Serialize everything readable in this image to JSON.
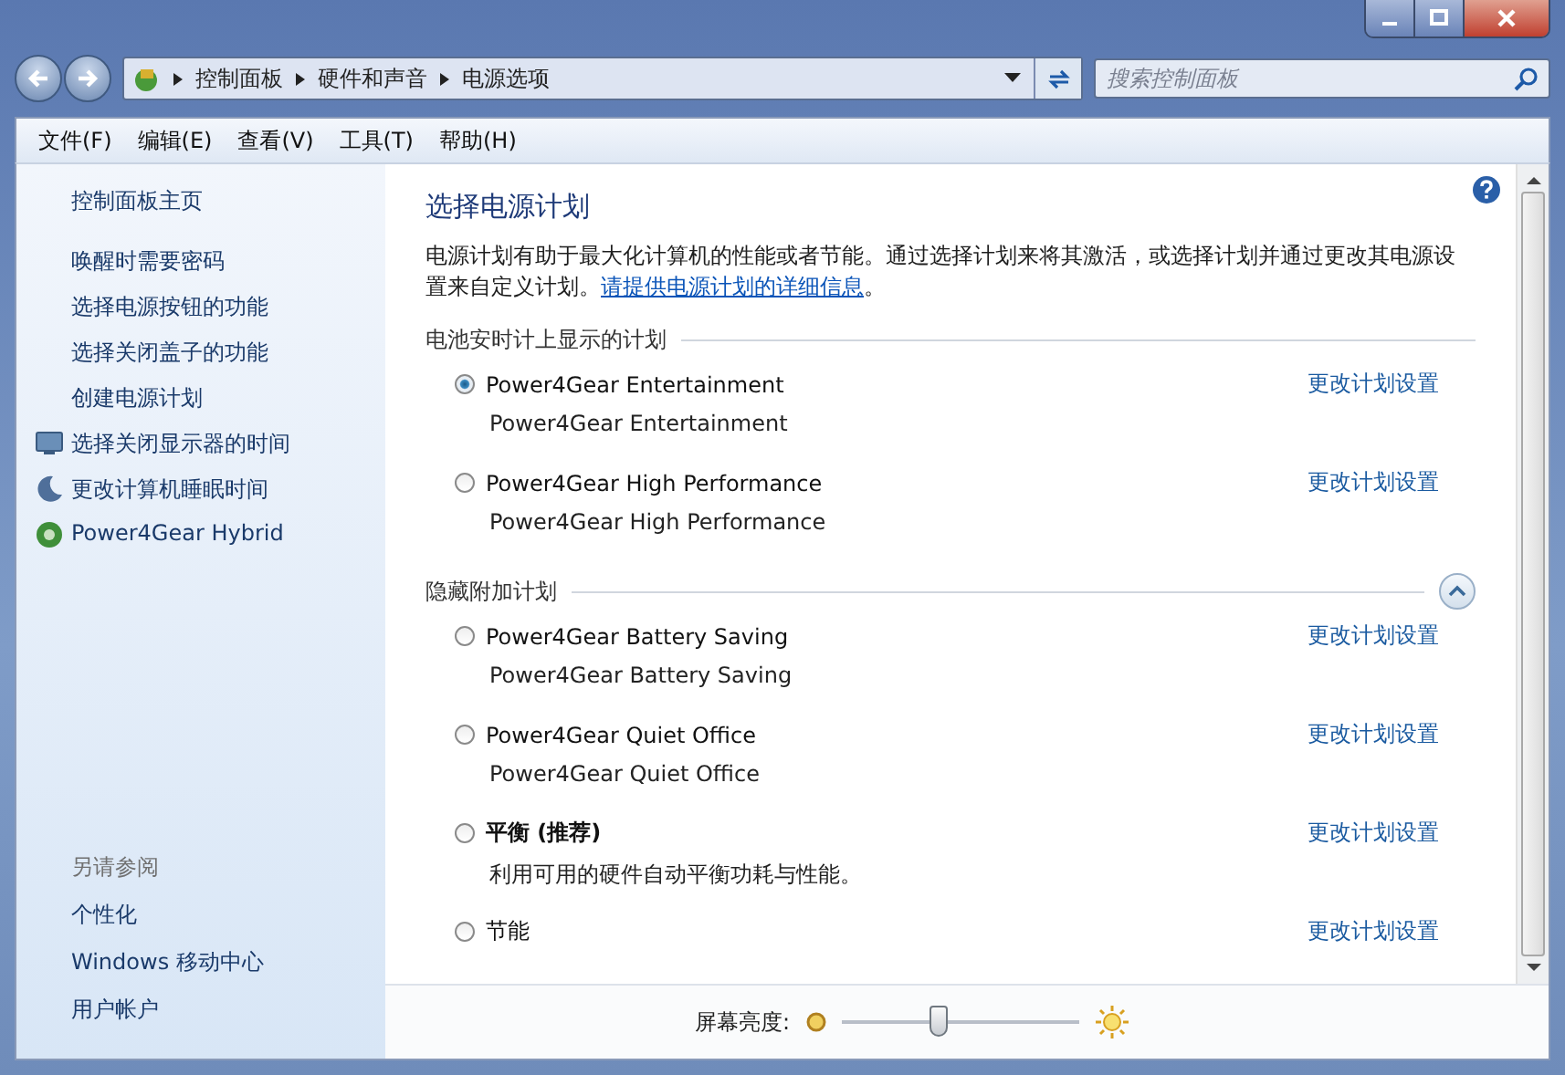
{
  "address_bar": {
    "crumbs": [
      "控制面板",
      "硬件和声音",
      "电源选项"
    ]
  },
  "search": {
    "placeholder": "搜索控制面板"
  },
  "menu": [
    "文件(F)",
    "编辑(E)",
    "查看(V)",
    "工具(T)",
    "帮助(H)"
  ],
  "sidebar": {
    "home": "控制面板主页",
    "tasks": [
      {
        "label": "唤醒时需要密码",
        "kind": "plain"
      },
      {
        "label": "选择电源按钮的功能",
        "kind": "plain"
      },
      {
        "label": "选择关闭盖子的功能",
        "kind": "plain"
      },
      {
        "label": "创建电源计划",
        "kind": "plain"
      },
      {
        "label": "选择关闭显示器的时间",
        "kind": "display"
      },
      {
        "label": "更改计算机睡眠时间",
        "kind": "sleep"
      },
      {
        "label": "Power4Gear Hybrid",
        "kind": "gear"
      }
    ],
    "see_also": {
      "title": "另请参阅",
      "items": [
        "个性化",
        "Windows 移动中心",
        "用户帐户"
      ]
    }
  },
  "main": {
    "title": "选择电源计划",
    "description": {
      "before": "电源计划有助于最大化计算机的性能或者节能。通过选择计划来将其激活，或选择计划并通过更改其电源设置来自定义计划。",
      "link": "请提供电源计划的详细信息",
      "after": "。"
    },
    "groups": [
      {
        "heading": "电池安时计上显示的计划",
        "plans": [
          {
            "name": "Power4Gear Entertainment",
            "description": "Power4Gear Entertainment",
            "link": "更改计划设置",
            "selected": true,
            "emphasized": false
          },
          {
            "name": "Power4Gear High Performance",
            "description": "Power4Gear High Performance",
            "link": "更改计划设置",
            "selected": false,
            "emphasized": false
          }
        ]
      },
      {
        "heading": "隐藏附加计划",
        "expanded": true,
        "plans": [
          {
            "name": "Power4Gear Battery Saving",
            "description": "Power4Gear Battery Saving",
            "link": "更改计划设置",
            "selected": false,
            "emphasized": false
          },
          {
            "name": "Power4Gear Quiet Office",
            "description": "Power4Gear Quiet Office",
            "link": "更改计划设置",
            "selected": false,
            "emphasized": false
          },
          {
            "name": "平衡 (推荐)",
            "description": "利用可用的硬件自动平衡功耗与性能。",
            "link": "更改计划设置",
            "selected": false,
            "emphasized": true
          },
          {
            "name": "节能",
            "link": "更改计划设置",
            "selected": false,
            "emphasized": false
          }
        ]
      }
    ]
  },
  "brightness": {
    "label": "屏幕亮度:",
    "level": 0.41
  }
}
